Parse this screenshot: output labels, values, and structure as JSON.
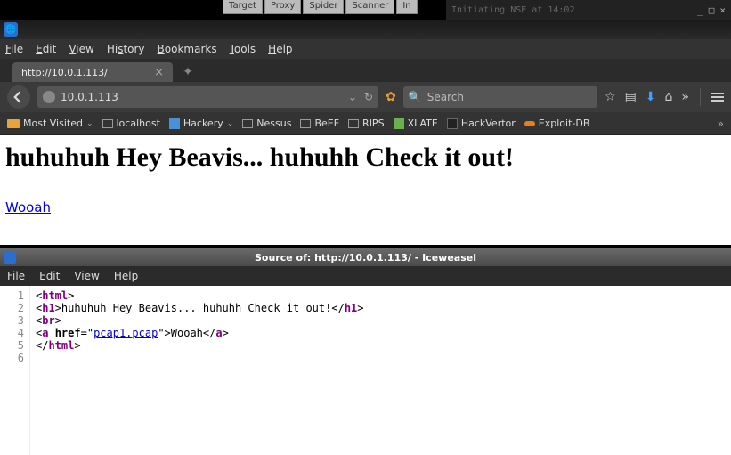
{
  "background": {
    "tabs": [
      "Target",
      "Proxy",
      "Spider",
      "Scanner",
      "In"
    ],
    "terminal_text": "Initiating NSE at 14:02"
  },
  "browser": {
    "menu": {
      "file": "File",
      "edit": "Edit",
      "view": "View",
      "history": "History",
      "bookmarks": "Bookmarks",
      "tools": "Tools",
      "help": "Help"
    },
    "tab_title": "http://10.0.1.113/",
    "url": "10.0.1.113",
    "search_placeholder": "Search",
    "bookmarks": {
      "most_visited": "Most Visited",
      "localhost": "localhost",
      "hackery": "Hackery",
      "nessus": "Nessus",
      "beef": "BeEF",
      "rips": "RIPS",
      "xlate": "XLATE",
      "hackvertor": "HackVertor",
      "exploitdb": "Exploit-DB"
    }
  },
  "page": {
    "heading": "huhuhuh Hey Beavis... huhuhh Check it out!",
    "link_text": "Wooah"
  },
  "source": {
    "title": "Source of: http://10.0.1.113/ - Iceweasel",
    "menu": {
      "file": "File",
      "edit": "Edit",
      "view": "View",
      "help": "Help"
    },
    "lines": {
      "l1_tag": "html",
      "l2_tag": "h1",
      "l2_text": "huhuhuh Hey Beavis... huhuhh  Check it out!",
      "l3_tag": "br",
      "l4_tag": "a",
      "l4_attr": "href",
      "l4_val": "pcap1.pcap",
      "l4_text": "Wooah",
      "l5_tag": "html"
    }
  }
}
